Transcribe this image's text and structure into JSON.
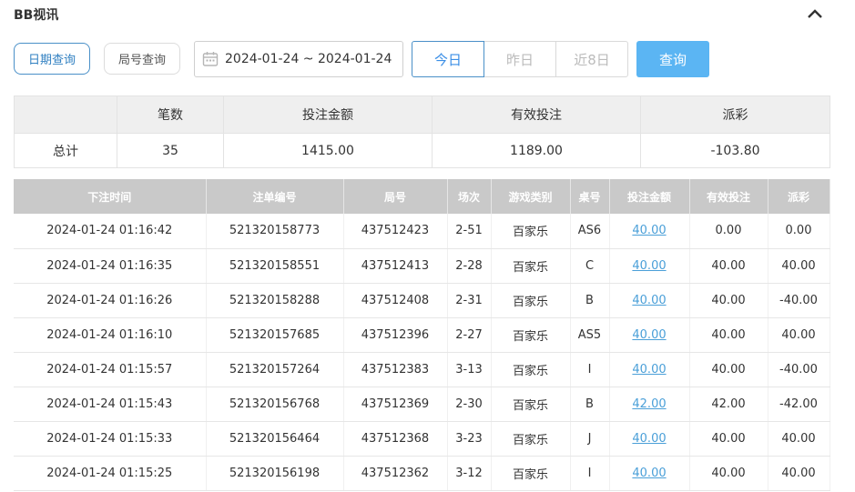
{
  "header": {
    "title": "BB视讯"
  },
  "filters": {
    "mode_date": "日期查询",
    "mode_round": "局号查询",
    "date_range": "2024-01-24 ~ 2024-01-24",
    "today": "今日",
    "yesterday": "昨日",
    "last8": "近8日",
    "query": "查询"
  },
  "summary": {
    "headers": [
      "",
      "笔数",
      "投注金额",
      "有效投注",
      "派彩"
    ],
    "row": [
      "总计",
      "35",
      "1415.00",
      "1189.00",
      "-103.80"
    ]
  },
  "table": {
    "headers": [
      "下注时间",
      "注单编号",
      "局号",
      "场次",
      "游戏类别",
      "桌号",
      "投注金额",
      "有效投注",
      "派彩"
    ],
    "rows": [
      [
        "2024-01-24 01:16:42",
        "521320158773",
        "437512423",
        "2-51",
        "百家乐",
        "AS6",
        "40.00",
        "0.00",
        "0.00"
      ],
      [
        "2024-01-24 01:16:35",
        "521320158551",
        "437512413",
        "2-28",
        "百家乐",
        "C",
        "40.00",
        "40.00",
        "40.00"
      ],
      [
        "2024-01-24 01:16:26",
        "521320158288",
        "437512408",
        "2-31",
        "百家乐",
        "B",
        "40.00",
        "40.00",
        "-40.00"
      ],
      [
        "2024-01-24 01:16:10",
        "521320157685",
        "437512396",
        "2-27",
        "百家乐",
        "AS5",
        "40.00",
        "40.00",
        "40.00"
      ],
      [
        "2024-01-24 01:15:57",
        "521320157264",
        "437512383",
        "3-13",
        "百家乐",
        "I",
        "40.00",
        "40.00",
        "-40.00"
      ],
      [
        "2024-01-24 01:15:43",
        "521320156768",
        "437512369",
        "2-30",
        "百家乐",
        "B",
        "42.00",
        "42.00",
        "-42.00"
      ],
      [
        "2024-01-24 01:15:33",
        "521320156464",
        "437512368",
        "3-23",
        "百家乐",
        "J",
        "40.00",
        "40.00",
        "40.00"
      ],
      [
        "2024-01-24 01:15:25",
        "521320156198",
        "437512362",
        "3-12",
        "百家乐",
        "I",
        "40.00",
        "40.00",
        "40.00"
      ]
    ]
  },
  "colors": {
    "accent": "#3a8ee6",
    "button": "#5bb5f3",
    "negative": "#e04a4a",
    "link": "#4a9fd8"
  },
  "icons": {
    "collapse": "chevron-up-icon",
    "calendar": "calendar-icon"
  }
}
